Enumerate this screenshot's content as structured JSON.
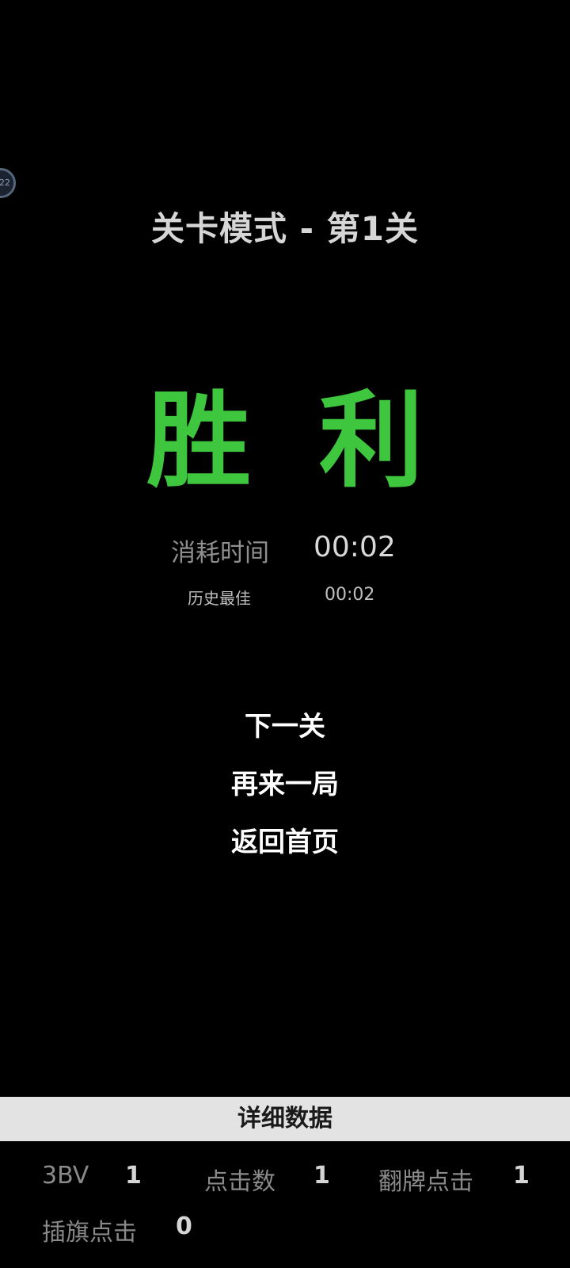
{
  "badge": {
    "text": "22"
  },
  "header": {
    "mode_title": "关卡模式 - 第1关"
  },
  "result": {
    "title": "胜 利",
    "color": "#3ec63e",
    "time_label": "消耗时间",
    "time_value": "00:02",
    "best_label": "历史最佳",
    "best_value": "00:02"
  },
  "actions": {
    "next_level": "下一关",
    "play_again": "再来一局",
    "back_home": "返回首页"
  },
  "details": {
    "header": "详细数据",
    "items": [
      {
        "label": "3BV",
        "value": "1"
      },
      {
        "label": "点击数",
        "value": "1"
      },
      {
        "label": "翻牌点击",
        "value": "1"
      },
      {
        "label": "插旗点击",
        "value": "0"
      }
    ]
  }
}
